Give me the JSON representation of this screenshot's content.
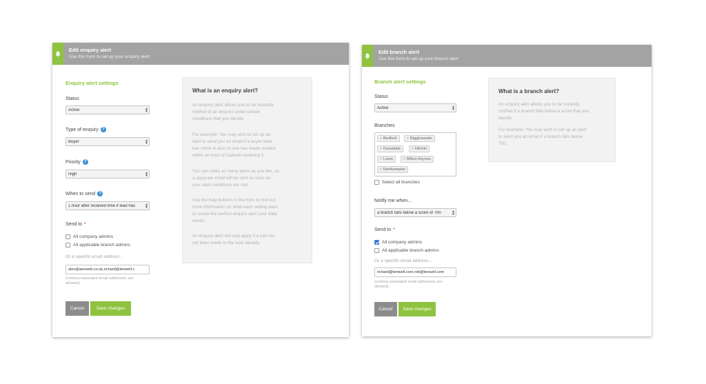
{
  "enquiry_panel": {
    "title": "Edit enquiry alert",
    "subtitle": "Use this form to set up your enquiry alert",
    "section_title": "Enquiry alert settings",
    "status": {
      "label": "Status",
      "value": "Active"
    },
    "type": {
      "label": "Type of enquiry",
      "value": "Buyer"
    },
    "priority": {
      "label": "Priority",
      "value": "High"
    },
    "when": {
      "label": "When to send",
      "value": "1 hour after received time if lead has"
    },
    "send_to": {
      "label": "Send to",
      "required_mark": "*",
      "options": [
        {
          "label": "All company admins",
          "checked": false
        },
        {
          "label": "All applicable branch admins",
          "checked": false
        }
      ],
      "email_label": "Or a specific email address...",
      "email_value": "alex@aesweb.co.uk,richard@tenwell.c",
      "email_hint_1": "(comma separated email addresses are",
      "email_hint_2": "allowed)"
    },
    "cancel_label": "Cancel",
    "save_label": "Save changes",
    "info": {
      "title": "What is an enquiry alert?",
      "paragraphs": [
        [
          "An enquiry alert allows you to be instantly",
          "notified of an enquiry under certain",
          "conditions that you decide."
        ],
        [
          "For example: You may wish to set up an",
          "alert to send you an email if a buyer lead",
          "has come in and no one has made contact",
          "within an hour of Callwell receiving it."
        ],
        [
          "You can make as many alerts as you like, as",
          "a separate email will be sent as soon as",
          "your alert conditions are met."
        ],
        [
          "Use the help buttons in the form to find out",
          "more information on what each setting does",
          "to create the perfect enquiry alert your daily",
          "needs."
        ],
        [
          "An enquiry alert will only apply if a call has",
          "not been made to the lead already."
        ]
      ]
    }
  },
  "branch_panel": {
    "title": "Edit branch alert",
    "subtitle": "Use this form to set up your branch alert",
    "section_title": "Branch alert settings",
    "status": {
      "label": "Status",
      "value": "Active"
    },
    "branches": {
      "label": "Branches",
      "tags": [
        "Bedford",
        "Biggleswade",
        "Dunstable",
        "Hitchin",
        "Luton",
        "Milton Keynes",
        "Northampton"
      ],
      "select_all_label": "Select all branches"
    },
    "notify": {
      "label": "Notify me when...",
      "value": "a branch falls below a score of 700"
    },
    "send_to": {
      "label": "Send to",
      "required_mark": "*",
      "options": [
        {
          "label": "All company admins",
          "checked": true
        },
        {
          "label": "All applicable branch admins",
          "checked": false
        }
      ],
      "email_label": "Or a specific email address...",
      "email_value": "richard@tenwell.com,rob@tenwell.com",
      "email_hint_1": "(comma separated email addresses are",
      "email_hint_2": "allowed)"
    },
    "cancel_label": "Cancel",
    "save_label": "Save changes",
    "info": {
      "title": "What is a branch alert?",
      "paragraphs": [
        [
          "An enquiry alert allows you to be instantly",
          "notified if a branch falls below a score that you",
          "decide."
        ],
        [
          "For example: You may wish to set up an alert",
          "to send you an email if a branch falls below",
          "700."
        ]
      ]
    }
  },
  "colors": {
    "accent": "#8ec33f",
    "header": "#a3a3a3",
    "help": "#3a8fd6",
    "cancel": "#8c8c8c"
  },
  "icons": {
    "header": "bell-icon",
    "help": "question-icon"
  }
}
